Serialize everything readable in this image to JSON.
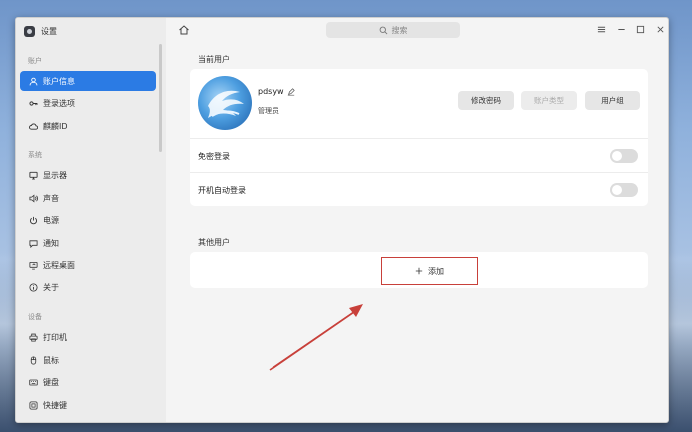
{
  "app": {
    "title": "设置"
  },
  "sidebar": {
    "sections": [
      {
        "label": "账户",
        "items": [
          {
            "label": "账户信息",
            "icon": "user-icon",
            "active": true
          },
          {
            "label": "登录选项",
            "icon": "key-icon"
          },
          {
            "label": "麒麟ID",
            "icon": "cloud-icon"
          }
        ]
      },
      {
        "label": "系统",
        "items": [
          {
            "label": "显示器",
            "icon": "monitor-icon"
          },
          {
            "label": "声音",
            "icon": "speaker-icon"
          },
          {
            "label": "电源",
            "icon": "power-icon"
          },
          {
            "label": "通知",
            "icon": "chat-icon"
          },
          {
            "label": "远程桌面",
            "icon": "remote-desktop-icon"
          },
          {
            "label": "关于",
            "icon": "info-icon"
          }
        ]
      },
      {
        "label": "设备",
        "items": [
          {
            "label": "打印机",
            "icon": "printer-icon"
          },
          {
            "label": "鼠标",
            "icon": "mouse-icon"
          },
          {
            "label": "键盘",
            "icon": "keyboard-icon"
          },
          {
            "label": "快捷键",
            "icon": "shortcut-icon"
          }
        ]
      }
    ]
  },
  "header": {
    "search_placeholder": "搜索"
  },
  "current_user": {
    "section_title": "当前用户",
    "username": "pdsyw",
    "role": "管理员",
    "buttons": {
      "change_password": "修改密码",
      "account_type": "账户类型",
      "user_group": "用户组"
    },
    "rows": {
      "password_free_login": "免密登录",
      "auto_login": "开机自动登录"
    }
  },
  "other_users": {
    "section_title": "其他用户",
    "add_label": "添加"
  },
  "colors": {
    "accent": "#2b7be4",
    "highlight_box": "#c8403a"
  }
}
